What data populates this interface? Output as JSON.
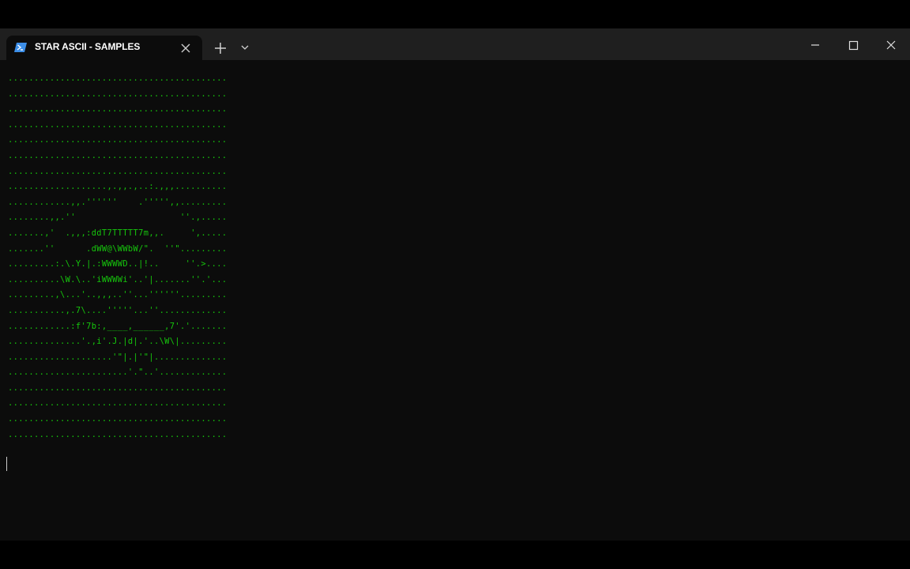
{
  "window": {
    "tab_title": "STAR ASCII - SAMPLES",
    "tab_icon": "powershell-icon",
    "buttons": {
      "new_tab": "plus-icon",
      "dropdown": "chevron-down-icon",
      "minimize": "minimize-icon",
      "maximize": "maximize-icon",
      "close": "close-icon"
    }
  },
  "colors": {
    "terminal_background": "#0c0c0c",
    "titlebar_background": "#1f1f1f",
    "ascii_foreground": "#16c60c",
    "tab_icon_accent": "#3c8ee8"
  },
  "terminal": {
    "ascii_art": "..........................................\n..........................................\n..........................................\n..........................................\n..........................................\n..........................................\n..........................................\n...................,.,,.,..:.,,,..........\n............,,.''''''    .''''',,.........\n........,,.''                    ''.,.....\n.......,'  .,,,:ddT7TTTTT7m,,.     ',.....\n.......''      .dWW@\\WWbW/\".  ''\".........\n.........:.\\.Y.|.:WWWWD..|!..     ''.>....\n..........\\W.\\..'iWWWWi'..'|.......''.'...\n.........,\\...'..,,,..''...''''''.........\n...........,.7\\....'''''...''.............\n............:f'7b:,____,______,7'.'.......\n..............'.,i'.J.|d|.'..\\W\\|.........\n....................'\"|.|'\"|..............\n.......................'.\"..'.............\n..........................................\n..........................................\n..........................................\n.........................................."
  }
}
